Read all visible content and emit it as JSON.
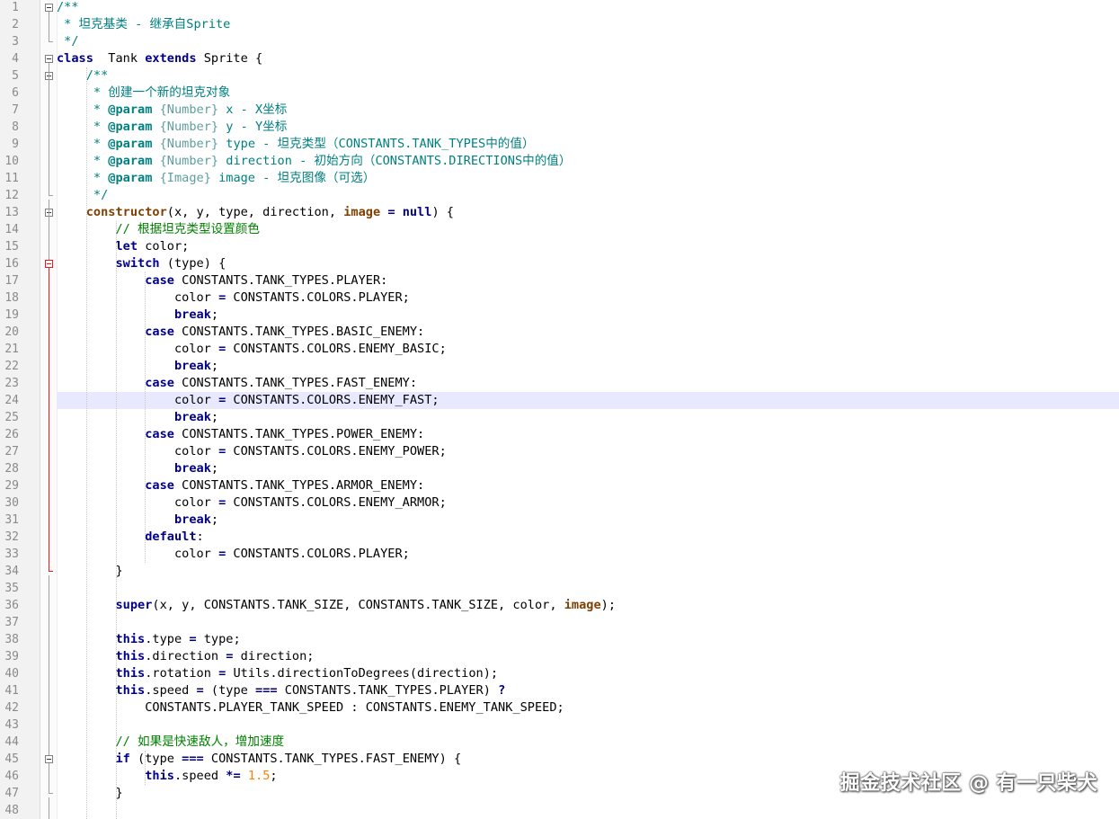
{
  "editor": {
    "current_line": 24,
    "colors": {
      "keyword": "#00008b",
      "comment": "#008000",
      "doc_comment": "#008080",
      "number": "#ff8000",
      "current_line_bg": "#e8e8ff",
      "fold_active": "#e02020"
    },
    "lines": [
      [
        [
          "cm",
          "/**"
        ]
      ],
      [
        [
          "cm",
          " * 坦克基类 - 继承自Sprite"
        ]
      ],
      [
        [
          "cm",
          " */"
        ]
      ],
      [
        [
          "kw",
          "class"
        ],
        [
          "",
          "  Tank "
        ],
        [
          "kw",
          "extends"
        ],
        [
          "",
          " Sprite {"
        ]
      ],
      [
        [
          "cm",
          "    /**"
        ]
      ],
      [
        [
          "cm",
          "     * 创建一个新的坦克对象"
        ]
      ],
      [
        [
          "cm",
          "     * "
        ],
        [
          "tag",
          "@param"
        ],
        [
          "ty",
          " {Number}"
        ],
        [
          "cm",
          " x - X坐标"
        ]
      ],
      [
        [
          "cm",
          "     * "
        ],
        [
          "tag",
          "@param"
        ],
        [
          "ty",
          " {Number}"
        ],
        [
          "cm",
          " y - Y坐标"
        ]
      ],
      [
        [
          "cm",
          "     * "
        ],
        [
          "tag",
          "@param"
        ],
        [
          "ty",
          " {Number}"
        ],
        [
          "cm",
          " type - 坦克类型（CONSTANTS.TANK_TYPES中的值）"
        ]
      ],
      [
        [
          "cm",
          "     * "
        ],
        [
          "tag",
          "@param"
        ],
        [
          "ty",
          " {Number}"
        ],
        [
          "cm",
          " direction - 初始方向（CONSTANTS.DIRECTIONS中的值）"
        ]
      ],
      [
        [
          "cm",
          "     * "
        ],
        [
          "tag",
          "@param"
        ],
        [
          "ty",
          " {Image}"
        ],
        [
          "cm",
          " image - 坦克图像（可选）"
        ]
      ],
      [
        [
          "cm",
          "     */"
        ]
      ],
      [
        [
          "",
          "    "
        ],
        [
          "fn",
          "constructor"
        ],
        [
          "",
          "(x, y, type, direction, "
        ],
        [
          "fn",
          "image"
        ],
        [
          "",
          " "
        ],
        [
          "op",
          "="
        ],
        [
          "",
          " "
        ],
        [
          "kw",
          "null"
        ],
        [
          "",
          ") {"
        ]
      ],
      [
        [
          "cmt",
          "        // 根据坦克类型设置颜色"
        ]
      ],
      [
        [
          "",
          "        "
        ],
        [
          "kw",
          "let"
        ],
        [
          "",
          " color;"
        ]
      ],
      [
        [
          "",
          "        "
        ],
        [
          "kw",
          "switch"
        ],
        [
          "",
          " (type) {"
        ]
      ],
      [
        [
          "",
          "            "
        ],
        [
          "kw",
          "case"
        ],
        [
          "",
          " CONSTANTS.TANK_TYPES.PLAYER:"
        ]
      ],
      [
        [
          "",
          "                color "
        ],
        [
          "op",
          "="
        ],
        [
          "",
          " CONSTANTS.COLORS.PLAYER;"
        ]
      ],
      [
        [
          "",
          "                "
        ],
        [
          "kw",
          "break"
        ],
        [
          "",
          ";"
        ]
      ],
      [
        [
          "",
          "            "
        ],
        [
          "kw",
          "case"
        ],
        [
          "",
          " CONSTANTS.TANK_TYPES.BASIC_ENEMY:"
        ]
      ],
      [
        [
          "",
          "                color "
        ],
        [
          "op",
          "="
        ],
        [
          "",
          " CONSTANTS.COLORS.ENEMY_BASIC;"
        ]
      ],
      [
        [
          "",
          "                "
        ],
        [
          "kw",
          "break"
        ],
        [
          "",
          ";"
        ]
      ],
      [
        [
          "",
          "            "
        ],
        [
          "kw",
          "case"
        ],
        [
          "",
          " CONSTANTS.TANK_TYPES.FAST_ENEMY:"
        ]
      ],
      [
        [
          "",
          "                color "
        ],
        [
          "op",
          "="
        ],
        [
          "",
          " CONSTANTS.COLORS.ENEMY_FAST;"
        ]
      ],
      [
        [
          "",
          "                "
        ],
        [
          "kw",
          "break"
        ],
        [
          "",
          ";"
        ]
      ],
      [
        [
          "",
          "            "
        ],
        [
          "kw",
          "case"
        ],
        [
          "",
          " CONSTANTS.TANK_TYPES.POWER_ENEMY:"
        ]
      ],
      [
        [
          "",
          "                color "
        ],
        [
          "op",
          "="
        ],
        [
          "",
          " CONSTANTS.COLORS.ENEMY_POWER;"
        ]
      ],
      [
        [
          "",
          "                "
        ],
        [
          "kw",
          "break"
        ],
        [
          "",
          ";"
        ]
      ],
      [
        [
          "",
          "            "
        ],
        [
          "kw",
          "case"
        ],
        [
          "",
          " CONSTANTS.TANK_TYPES.ARMOR_ENEMY:"
        ]
      ],
      [
        [
          "",
          "                color "
        ],
        [
          "op",
          "="
        ],
        [
          "",
          " CONSTANTS.COLORS.ENEMY_ARMOR;"
        ]
      ],
      [
        [
          "",
          "                "
        ],
        [
          "kw",
          "break"
        ],
        [
          "",
          ";"
        ]
      ],
      [
        [
          "",
          "            "
        ],
        [
          "kw",
          "default"
        ],
        [
          "",
          ":"
        ]
      ],
      [
        [
          "",
          "                color "
        ],
        [
          "op",
          "="
        ],
        [
          "",
          " CONSTANTS.COLORS.PLAYER;"
        ]
      ],
      [
        [
          "",
          "        }"
        ]
      ],
      [],
      [
        [
          "",
          "        "
        ],
        [
          "kw",
          "super"
        ],
        [
          "",
          "(x, y, CONSTANTS.TANK_SIZE, CONSTANTS.TANK_SIZE, color, "
        ],
        [
          "fn",
          "image"
        ],
        [
          "",
          ");"
        ]
      ],
      [],
      [
        [
          "",
          "        "
        ],
        [
          "kw",
          "this"
        ],
        [
          "",
          ".type "
        ],
        [
          "op",
          "="
        ],
        [
          "",
          " type;"
        ]
      ],
      [
        [
          "",
          "        "
        ],
        [
          "kw",
          "this"
        ],
        [
          "",
          ".direction "
        ],
        [
          "op",
          "="
        ],
        [
          "",
          " direction;"
        ]
      ],
      [
        [
          "",
          "        "
        ],
        [
          "kw",
          "this"
        ],
        [
          "",
          ".rotation "
        ],
        [
          "op",
          "="
        ],
        [
          "",
          " Utils.directionToDegrees(direction);"
        ]
      ],
      [
        [
          "",
          "        "
        ],
        [
          "kw",
          "this"
        ],
        [
          "",
          ".speed "
        ],
        [
          "op",
          "="
        ],
        [
          "",
          " (type "
        ],
        [
          "op",
          "==="
        ],
        [
          "",
          " CONSTANTS.TANK_TYPES.PLAYER) "
        ],
        [
          "op",
          "?"
        ]
      ],
      [
        [
          "",
          "            CONSTANTS.PLAYER_TANK_SPEED : CONSTANTS.ENEMY_TANK_SPEED;"
        ]
      ],
      [],
      [
        [
          "cmt",
          "        // 如果是快速敌人，增加速度"
        ]
      ],
      [
        [
          "",
          "        "
        ],
        [
          "kw",
          "if"
        ],
        [
          "",
          " (type "
        ],
        [
          "op",
          "==="
        ],
        [
          "",
          " CONSTANTS.TANK_TYPES.FAST_ENEMY) {"
        ]
      ],
      [
        [
          "",
          "            "
        ],
        [
          "kw",
          "this"
        ],
        [
          "",
          ".speed "
        ],
        [
          "op",
          "*="
        ],
        [
          "",
          " "
        ],
        [
          "num",
          "1.5"
        ],
        [
          "",
          ";"
        ]
      ],
      [
        [
          "",
          "        }"
        ]
      ],
      []
    ]
  },
  "watermark": {
    "text": "掘金技术社区 @ 有一只柴犬"
  }
}
